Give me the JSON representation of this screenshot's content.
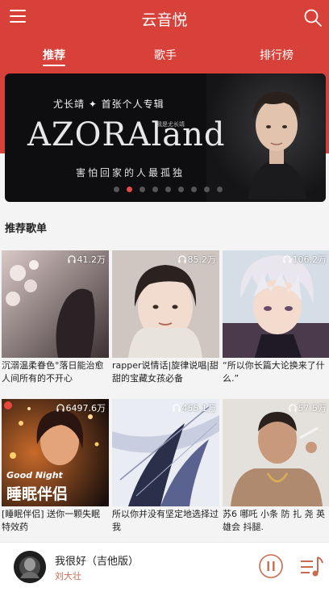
{
  "app": {
    "title": "云音悦"
  },
  "tabs": [
    {
      "label": "推荐",
      "active": true
    },
    {
      "label": "歌手",
      "active": false
    },
    {
      "label": "排行榜",
      "active": false
    }
  ],
  "banner": {
    "subtitle": "尤长靖 ✦ 首张个人专辑",
    "headline": "AZORAland",
    "tag": "我是尤长靖",
    "caption": "害怕回家的人最孤独",
    "dots_total": 9,
    "active_dot": 1
  },
  "section": {
    "title": "推荐歌单"
  },
  "playlists": [
    {
      "count": "41.2万",
      "caption": "沉溺温柔眷色°落日能治愈人间所有的不开心"
    },
    {
      "count": "85.2万",
      "caption": "rapper说情话|旋律说唱|甜甜的宝藏女孩必备"
    },
    {
      "count": "106.2万",
      "caption": "“所以你长篇大论换来了什么.”"
    },
    {
      "count": "6497.6万",
      "caption": "[睡眠伴侣] 送你一颗失眠特效药",
      "overlay_small": "Good Night",
      "overlay_big": "睡眠伴侣"
    },
    {
      "count": "455.1万",
      "caption": "所以你并没有坚定地选择过我"
    },
    {
      "count": "57.5万",
      "caption": "苏6 哪吒 小条 防 扎 尧 英雄会 抖腿."
    }
  ],
  "player": {
    "song": "我很好（吉他版）",
    "artist": "刘大壮"
  },
  "colors": {
    "accent": "#d8413a",
    "artist": "#c96a52"
  }
}
